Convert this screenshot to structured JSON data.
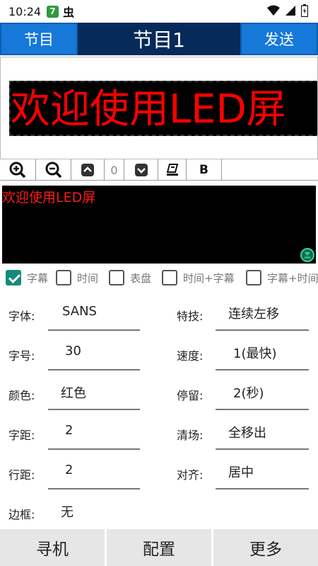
{
  "status_bar": {
    "time": "10:24",
    "badge": "7",
    "bug_glyph": "虫"
  },
  "title_bar": {
    "left_button": "节目",
    "title": "节目1",
    "right_button": "发送"
  },
  "preview": {
    "led_text": "欢迎使用LED屏"
  },
  "toolbar": {
    "zoom_in_icon": "zoom-in-icon",
    "zoom_out_icon": "zoom-out-icon",
    "up_icon": "chevron-up-icon",
    "value": "0",
    "down_icon": "chevron-down-icon",
    "eraser_icon": "eraser-icon",
    "bold_label": "B"
  },
  "editor": {
    "text": "欢迎使用LED屏"
  },
  "checkboxes": [
    {
      "label": "字幕",
      "checked": true
    },
    {
      "label": "时间",
      "checked": false
    },
    {
      "label": "表盘",
      "checked": false
    },
    {
      "label": "时间+字幕",
      "checked": false
    },
    {
      "label": "字幕+时间",
      "checked": false
    }
  ],
  "form": {
    "font_label": "字体:",
    "font_value": "SANS",
    "effect_label": "特技:",
    "effect_value": "连续左移",
    "size_label": "字号:",
    "size_value": "30",
    "speed_label": "速度:",
    "speed_value": "1(最快)",
    "color_label": "颜色:",
    "color_value": "红色",
    "stay_label": "停留:",
    "stay_value": "2(秒)",
    "spacing_label": "字距:",
    "spacing_value": "2",
    "clear_label": "清场:",
    "clear_value": "全移出",
    "line_spacing_label": "行距:",
    "line_spacing_value": "2",
    "align_label": "对齐:",
    "align_value": "居中",
    "border_label": "边框:",
    "border_value": "无"
  },
  "bottom_bar": {
    "search": "寻机",
    "config": "配置",
    "more": "更多"
  },
  "colors": {
    "title_bg": "#062a5a",
    "button_blue": "#1678d9",
    "led_red": "#ff0000",
    "check_teal": "#148a7e"
  }
}
